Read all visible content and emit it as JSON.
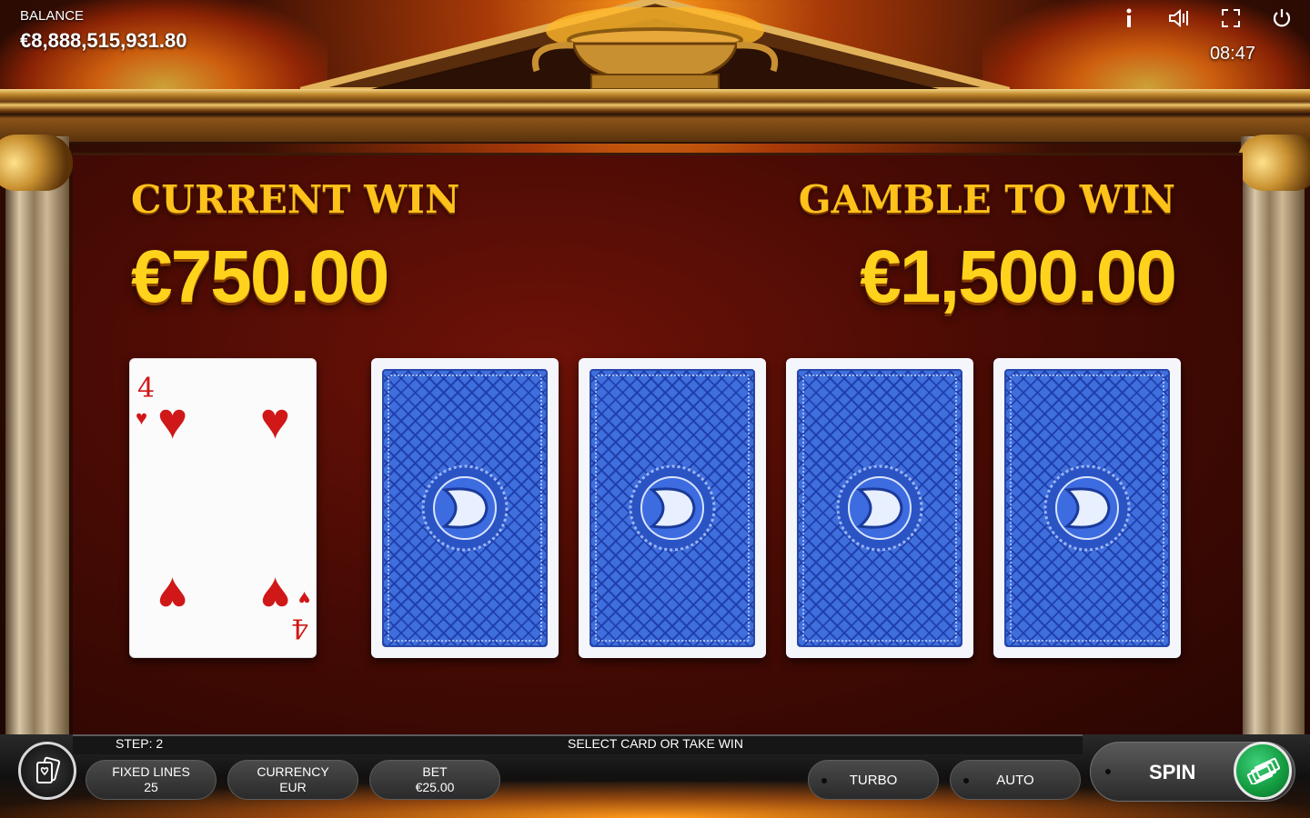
{
  "header": {
    "balance_label": "BALANCE",
    "balance_value": "€8,888,515,931.80",
    "clock": "08:47",
    "icons": [
      "info-icon",
      "sound-icon",
      "fullscreen-icon",
      "power-icon"
    ]
  },
  "gamble": {
    "current_win_label": "CURRENT WIN",
    "current_win_amount": "€750.00",
    "gamble_label": "GAMBLE TO WIN",
    "gamble_amount": "€1,500.00"
  },
  "dealer_card": {
    "rank": "4",
    "suit": "♥",
    "suit_color": "#d01818"
  },
  "hidden_cards": 4,
  "card_back_color": "#3e6fdc",
  "status": {
    "step": "STEP: 2",
    "hint": "SELECT CARD OR TAKE WIN"
  },
  "controls": {
    "fixed_lines_label": "FIXED LINES",
    "fixed_lines_value": "25",
    "currency_label": "CURRENCY",
    "currency_value": "EUR",
    "bet_label": "BET",
    "bet_value": "€25.00",
    "turbo_label": "TURBO",
    "auto_label": "AUTO",
    "spin_label": "SPIN"
  },
  "colors": {
    "gold_text": "#ffc21a",
    "panel_bg": "#4a0b04",
    "take_win_button": "#12993e"
  }
}
